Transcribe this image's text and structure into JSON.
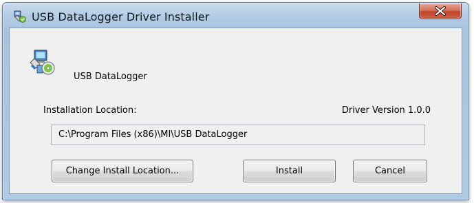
{
  "window": {
    "title": "USB DataLogger Driver Installer",
    "icon": "installer-icon",
    "close_icon": "close-icon"
  },
  "product": {
    "icon": "installer-package-icon",
    "name": "USB DataLogger"
  },
  "installation": {
    "location_label": "Installation Location:",
    "driver_version": "Driver Version 1.0.0",
    "path": "C:\\Program Files (x86)\\MI\\USB DataLogger"
  },
  "buttons": {
    "change_location": "Change Install Location...",
    "install": "Install",
    "cancel": "Cancel"
  },
  "colors": {
    "client_background": "#f0f0f0",
    "close_button": "#c0442a",
    "title_bar": "#b5cde6"
  }
}
